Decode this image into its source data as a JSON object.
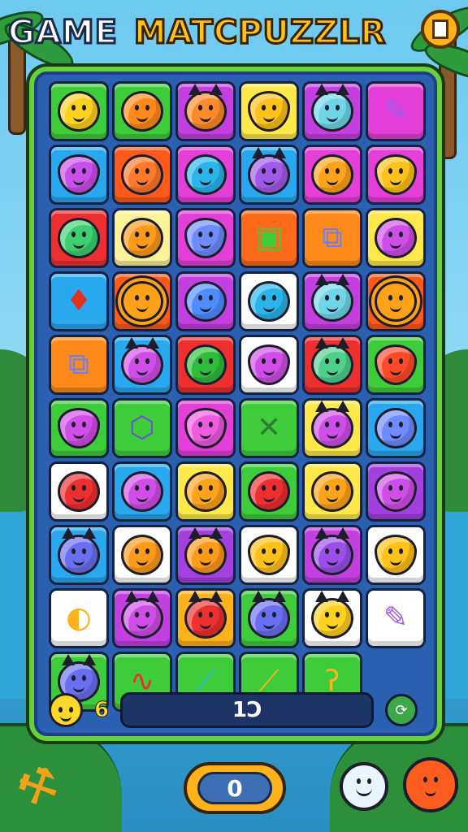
{
  "header": {
    "title_part1": "GAME",
    "title_part2": "MATCPUZZLR",
    "pause_icon": "pause-icon"
  },
  "board": {
    "rows": [
      [
        {
          "bg": "#3fcc3a",
          "kind": "pineapple",
          "color": "#ffd21f",
          "icon": "pineapple-icon"
        },
        {
          "bg": "#3fcc3a",
          "kind": "fruit",
          "color": "#ff8a1a",
          "icon": "orange-fruit-icon"
        },
        {
          "bg": "#c43fe0",
          "kind": "cat",
          "color": "#ff8a2a",
          "icon": "orange-cat-icon"
        },
        {
          "bg": "#ffe94a",
          "kind": "drop",
          "color": "#ffc21a",
          "icon": "yellow-blob-icon"
        },
        {
          "bg": "#c43fe0",
          "kind": "cat",
          "color": "#6fd6e8",
          "icon": "blue-cat-icon"
        },
        {
          "bg": "#e43fd8",
          "kind": "tool",
          "glyph": "✎",
          "color": "#9b5cf0",
          "icon": "pencil-icon"
        }
      ],
      [
        {
          "bg": "#2aa8ef",
          "kind": "drop",
          "color": "#c84fe8",
          "icon": "purple-blob-icon"
        },
        {
          "bg": "#ff5a1a",
          "kind": "blob",
          "color": "#ff7a2a",
          "icon": "orange-blob-icon"
        },
        {
          "bg": "#e43fd8",
          "kind": "fruit",
          "color": "#2ab4ea",
          "icon": "blue-lollipop-icon"
        },
        {
          "bg": "#2aa8ef",
          "kind": "cat",
          "color": "#a05ae8",
          "icon": "purple-cat-icon"
        },
        {
          "bg": "#e43fd8",
          "kind": "fruit",
          "color": "#ffa41a",
          "icon": "orange-fruit-icon"
        },
        {
          "bg": "#e43fd8",
          "kind": "drop",
          "color": "#ffc21a",
          "icon": "yellow-blob-icon"
        }
      ],
      [
        {
          "bg": "#ee2f2f",
          "kind": "fruit",
          "color": "#3ed070",
          "icon": "green-blob-icon"
        },
        {
          "bg": "#fff39a",
          "kind": "fruit",
          "color": "#ff9a1a",
          "icon": "mango-icon"
        },
        {
          "bg": "#e43fd8",
          "kind": "drop",
          "color": "#6e8cff",
          "icon": "blue-blob-icon"
        },
        {
          "bg": "#ff6a1a",
          "kind": "tool",
          "glyph": "▣",
          "color": "#3fcc3a",
          "icon": "book-icon"
        },
        {
          "bg": "#ff8a1a",
          "kind": "tool",
          "glyph": "⧉",
          "color": "#6a7fff",
          "icon": "scroll-icon"
        },
        {
          "bg": "#ffe94a",
          "kind": "fruit",
          "color": "#d04ee8",
          "icon": "purple-fruit-icon"
        }
      ],
      [
        {
          "bg": "#2aa8ef",
          "kind": "tool",
          "glyph": "♦",
          "color": "#e0321f",
          "icon": "red-fish-icon"
        },
        {
          "bg": "#ff5a1a",
          "kind": "sun",
          "color": "#ffa21a",
          "icon": "sun-icon"
        },
        {
          "bg": "#c43fe0",
          "kind": "blob",
          "color": "#4f8cff",
          "icon": "blue-blob-icon"
        },
        {
          "bg": "#ffffff",
          "kind": "fruit",
          "color": "#2ab4ea",
          "icon": "blue-lollipop-icon"
        },
        {
          "bg": "#c43fe0",
          "kind": "cat",
          "color": "#6fd6e8",
          "icon": "blue-cat-icon"
        },
        {
          "bg": "#ff5a1a",
          "kind": "sun",
          "color": "#ffa21a",
          "icon": "sun-icon"
        }
      ],
      [
        {
          "bg": "#ff8a1a",
          "kind": "tool",
          "glyph": "⧉",
          "color": "#6a7fff",
          "icon": "scroll-icon"
        },
        {
          "bg": "#2aa8ef",
          "kind": "cat",
          "color": "#d04ee8",
          "icon": "purple-cat-icon"
        },
        {
          "bg": "#ee2f2f",
          "kind": "fruit",
          "color": "#2dbd3a",
          "icon": "green-lollipop-icon"
        },
        {
          "bg": "#ffffff",
          "kind": "drop",
          "color": "#d04ee8",
          "icon": "purple-blob-icon"
        },
        {
          "bg": "#ee2f2f",
          "kind": "cat",
          "color": "#4fd08a",
          "icon": "green-cat-icon"
        },
        {
          "bg": "#3fcc3a",
          "kind": "drop",
          "color": "#ff4a2a",
          "icon": "red-blob-icon"
        }
      ],
      [
        {
          "bg": "#3fcc3a",
          "kind": "drop",
          "color": "#d04ee8",
          "icon": "purple-blob-icon"
        },
        {
          "bg": "#3fcc3a",
          "kind": "tool",
          "glyph": "⬡",
          "color": "#6a4fd8",
          "icon": "kite-icon"
        },
        {
          "bg": "#e43fd8",
          "kind": "drop",
          "color": "#ee5ae0",
          "icon": "pink-blob-icon"
        },
        {
          "bg": "#3fcc3a",
          "kind": "tool",
          "glyph": "✕",
          "color": "#2e7d32",
          "icon": "crossed-swords-icon"
        },
        {
          "bg": "#ffe94a",
          "kind": "cat",
          "color": "#d04ee8",
          "icon": "purple-cat-icon"
        },
        {
          "bg": "#2aa8ef",
          "kind": "blob",
          "color": "#6e8cff",
          "icon": "blue-blob-icon"
        }
      ],
      [
        {
          "bg": "#ffffff",
          "kind": "fruit",
          "color": "#ee2f2f",
          "icon": "red-apple-icon"
        },
        {
          "bg": "#2aa8ef",
          "kind": "fruit",
          "color": "#d04ee8",
          "icon": "purple-plum-icon"
        },
        {
          "bg": "#ffe94a",
          "kind": "fruit",
          "color": "#ffa41a",
          "icon": "orange-ball-icon"
        },
        {
          "bg": "#3fcc3a",
          "kind": "fruit",
          "color": "#ee2f2f",
          "icon": "red-ball-icon"
        },
        {
          "bg": "#ffe94a",
          "kind": "fruit",
          "color": "#ffa41a",
          "icon": "orange-fruit-icon"
        },
        {
          "bg": "#a43fe0",
          "kind": "drop",
          "color": "#d04ee8",
          "icon": "purple-blob-icon"
        }
      ],
      [
        {
          "bg": "#2aa8ef",
          "kind": "cat",
          "color": "#6a6ef0",
          "icon": "blue-cat-icon"
        },
        {
          "bg": "#ffffff",
          "kind": "fruit",
          "color": "#ff9a1a",
          "icon": "orange-ball-icon"
        },
        {
          "bg": "#a43fe0",
          "kind": "cat",
          "color": "#ff9a1a",
          "icon": "orange-cat-icon"
        },
        {
          "bg": "#ffffff",
          "kind": "drop",
          "color": "#ffc21a",
          "icon": "yellow-blob-icon"
        },
        {
          "bg": "#c43fe0",
          "kind": "cat",
          "color": "#9b4fe8",
          "icon": "purple-cat-icon"
        },
        {
          "bg": "#ffffff",
          "kind": "drop",
          "color": "#ffc21a",
          "icon": "yellow-blob-icon"
        }
      ],
      [
        {
          "bg": "#ffffff",
          "kind": "tool",
          "glyph": "◐",
          "color": "#ffb21a",
          "icon": "striped-ball-icon"
        },
        {
          "bg": "#c43fe0",
          "kind": "cat",
          "color": "#d04ee8",
          "icon": "purple-cat-icon"
        },
        {
          "bg": "#ffb21a",
          "kind": "cat",
          "color": "#ee2f2f",
          "icon": "red-cat-icon"
        },
        {
          "bg": "#3fcc3a",
          "kind": "cat",
          "color": "#6a6ef0",
          "icon": "blue-cat-icon"
        },
        {
          "bg": "#ffffff",
          "kind": "cat",
          "color": "#ffd21f",
          "icon": "yellow-cat-icon"
        },
        {
          "bg": "#ffffff",
          "kind": "tool",
          "glyph": "✎",
          "color": "#9b5cf0",
          "icon": "pencil-icon"
        }
      ],
      [
        {
          "bg": "#3fcc3a",
          "kind": "cat",
          "color": "#6a6ef0",
          "icon": "blue-cat-icon"
        },
        {
          "bg": "#3fcc3a",
          "kind": "tool",
          "glyph": "∿",
          "color": "#ee2f2f",
          "icon": "red-worm-icon"
        },
        {
          "bg": "#3fcc3a",
          "kind": "tool",
          "glyph": "⟋",
          "color": "#2ab4ea",
          "icon": "blue-knife-icon"
        },
        {
          "bg": "#3fcc3a",
          "kind": "tool",
          "glyph": "⟋",
          "color": "#ffb21a",
          "icon": "dagger-icon"
        },
        {
          "bg": "#3fcc3a",
          "kind": "tool",
          "glyph": "ʔ",
          "color": "#ffb21a",
          "icon": "hook-icon"
        }
      ]
    ]
  },
  "hud": {
    "face_icon": "smiley-face-icon",
    "moves": "6",
    "progress_text": "1Ͻ",
    "refresh_icon": "refresh-icon"
  },
  "footer": {
    "score": "0",
    "hammer_icon": "hammer-icon",
    "robot_icon": "robot-face-icon",
    "bomb_icon": "orange-bomb-icon"
  }
}
